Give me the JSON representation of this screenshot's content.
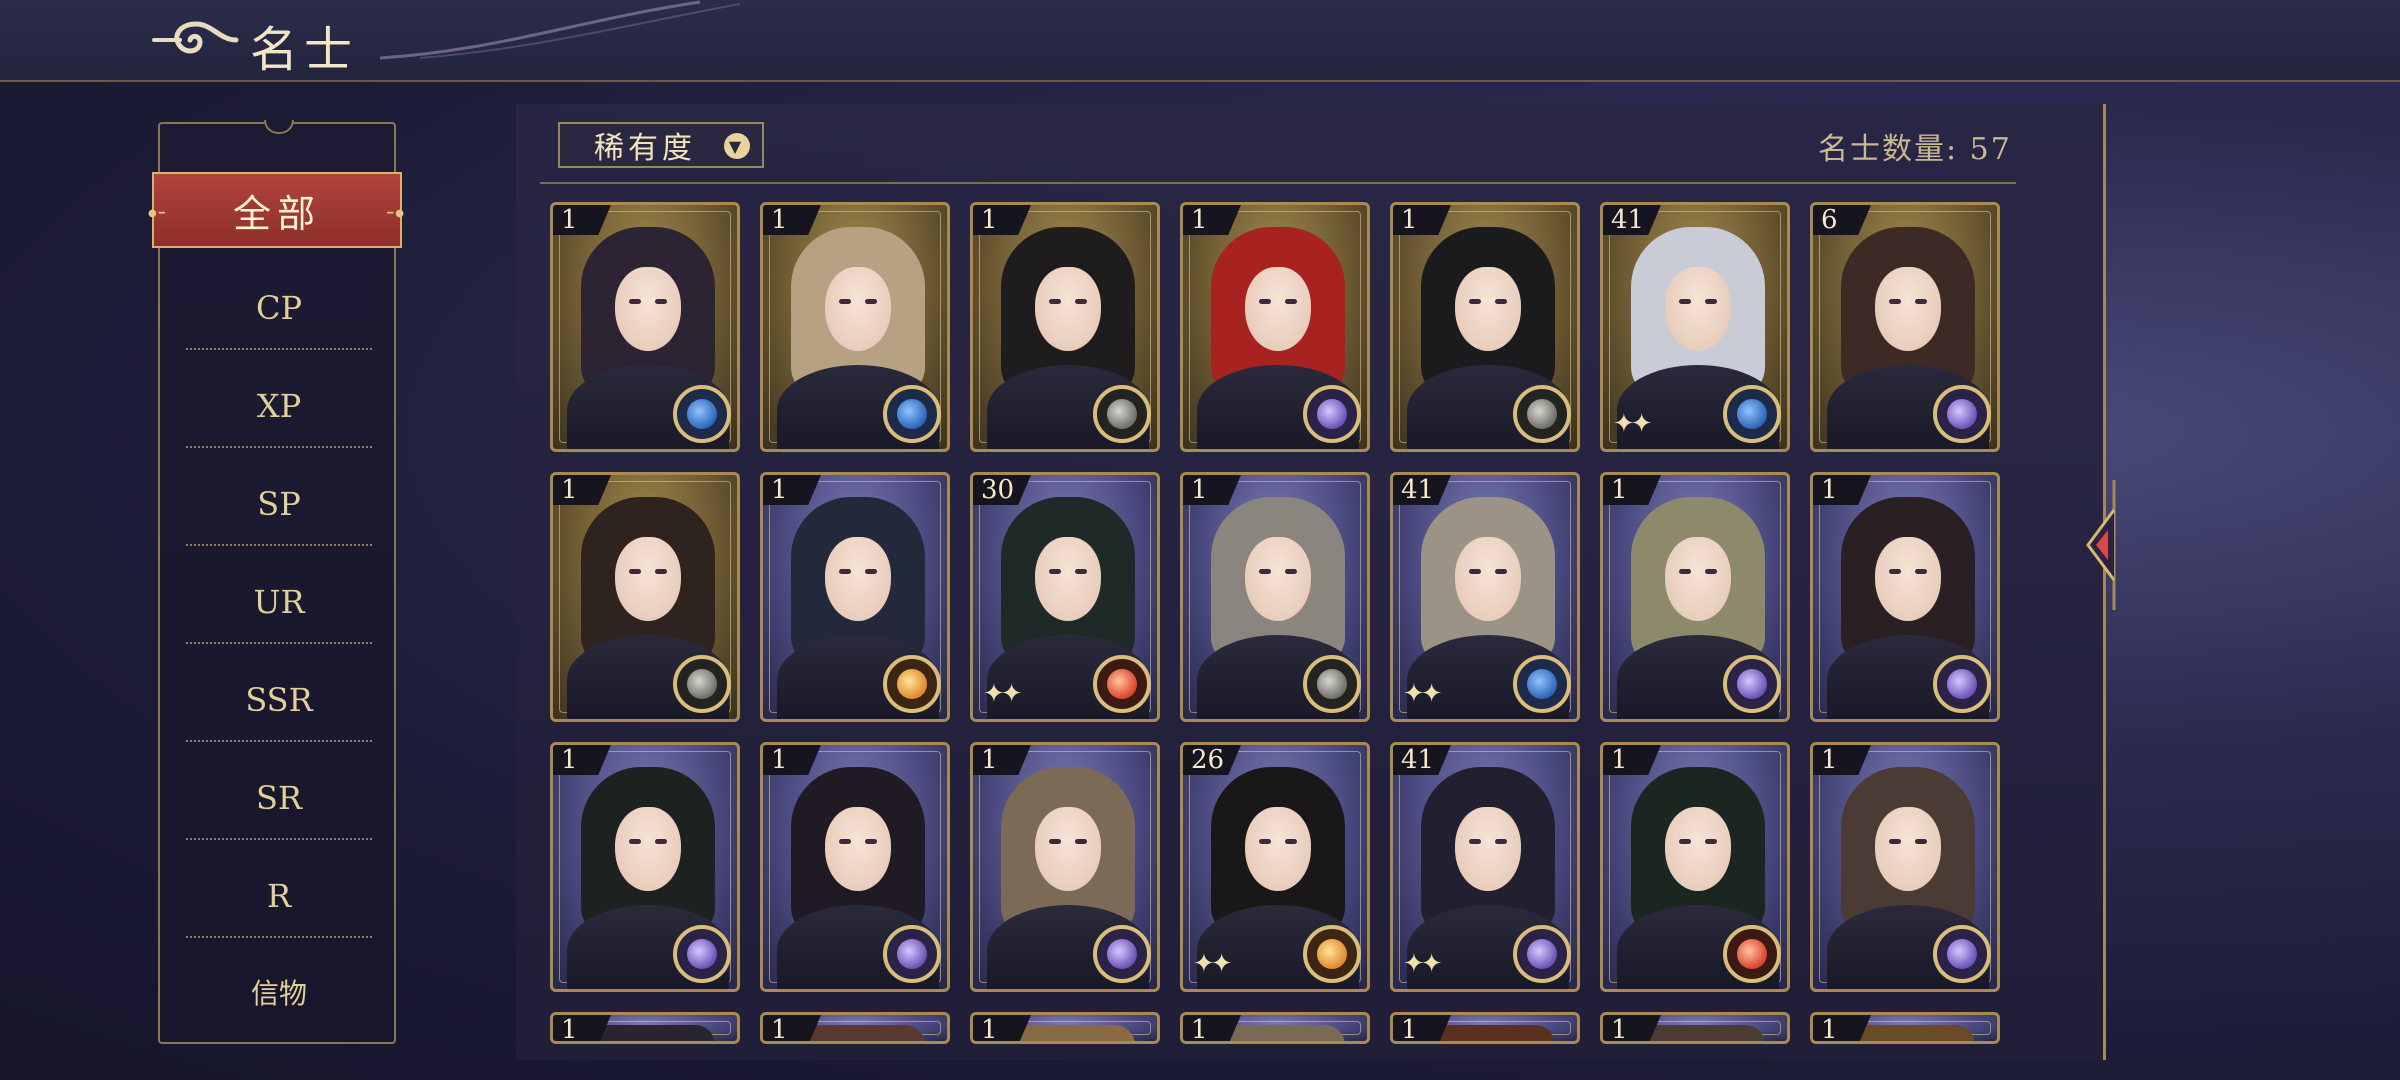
{
  "header": {
    "title": "名士"
  },
  "sidebar": {
    "active": "全部",
    "items": [
      "CP",
      "XP",
      "SP",
      "UR",
      "SSR",
      "SR",
      "R",
      "信物"
    ]
  },
  "filter": {
    "label": "稀有度",
    "count_text": "名士数量: 57"
  },
  "colors": {
    "accent_red": "#a63a35",
    "gold": "#d9bd7a",
    "panel": "#1c1b36"
  },
  "cards": [
    {
      "level": "1",
      "theme": "gold",
      "element": "blue",
      "hair": "#2d2433"
    },
    {
      "level": "1",
      "theme": "gold",
      "element": "blue",
      "hair": "#b7a183"
    },
    {
      "level": "1",
      "theme": "gold",
      "element": "dark",
      "hair": "#1e1c1d"
    },
    {
      "level": "1",
      "theme": "gold",
      "element": "purple",
      "hair": "#a8231f"
    },
    {
      "level": "1",
      "theme": "gold",
      "element": "dark",
      "hair": "#1b1a1c"
    },
    {
      "level": "41",
      "theme": "gold",
      "element": "blue",
      "hair": "#c9ccd6",
      "sparkle": true
    },
    {
      "level": "6",
      "theme": "gold",
      "element": "purple",
      "hair": "#3d2a24"
    },
    {
      "level": "1",
      "theme": "gold",
      "element": "dark",
      "hair": "#2e231f"
    },
    {
      "level": "1",
      "theme": "purple",
      "element": "orange",
      "hair": "#23293a"
    },
    {
      "level": "30",
      "theme": "purple",
      "element": "red",
      "hair": "#1f2a28",
      "sparkle": true
    },
    {
      "level": "1",
      "theme": "purple",
      "element": "dark",
      "hair": "#8a857e"
    },
    {
      "level": "41",
      "theme": "purple",
      "element": "blue",
      "hair": "#9b9486",
      "sparkle": true
    },
    {
      "level": "1",
      "theme": "purple",
      "element": "purple",
      "hair": "#8c8a6a"
    },
    {
      "level": "1",
      "theme": "purple",
      "element": "purple",
      "hair": "#2a1f22"
    },
    {
      "level": "1",
      "theme": "purple",
      "element": "purple",
      "hair": "#1d2120"
    },
    {
      "level": "1",
      "theme": "purple",
      "element": "purple",
      "hair": "#1f1a24"
    },
    {
      "level": "1",
      "theme": "purple",
      "element": "purple",
      "hair": "#7b6a55"
    },
    {
      "level": "26",
      "theme": "purple",
      "element": "orange",
      "hair": "#1a1719",
      "sparkle": true
    },
    {
      "level": "41",
      "theme": "purple",
      "element": "purple",
      "hair": "#222030",
      "sparkle": true
    },
    {
      "level": "1",
      "theme": "purple",
      "element": "red",
      "hair": "#1c2621"
    },
    {
      "level": "1",
      "theme": "purple",
      "element": "purple",
      "hair": "#4a3c34"
    },
    {
      "level": "1",
      "theme": "purple",
      "hair": "#2a2330"
    },
    {
      "level": "1",
      "theme": "purple",
      "hair": "#5a3a30"
    },
    {
      "level": "1",
      "theme": "purple",
      "hair": "#8a6a44"
    },
    {
      "level": "1",
      "theme": "purple",
      "hair": "#7a6a55"
    },
    {
      "level": "1",
      "theme": "purple",
      "hair": "#5a3020"
    },
    {
      "level": "1",
      "theme": "purple",
      "hair": "#4a3c34"
    },
    {
      "level": "1",
      "theme": "purple",
      "hair": "#6a4a28"
    }
  ]
}
